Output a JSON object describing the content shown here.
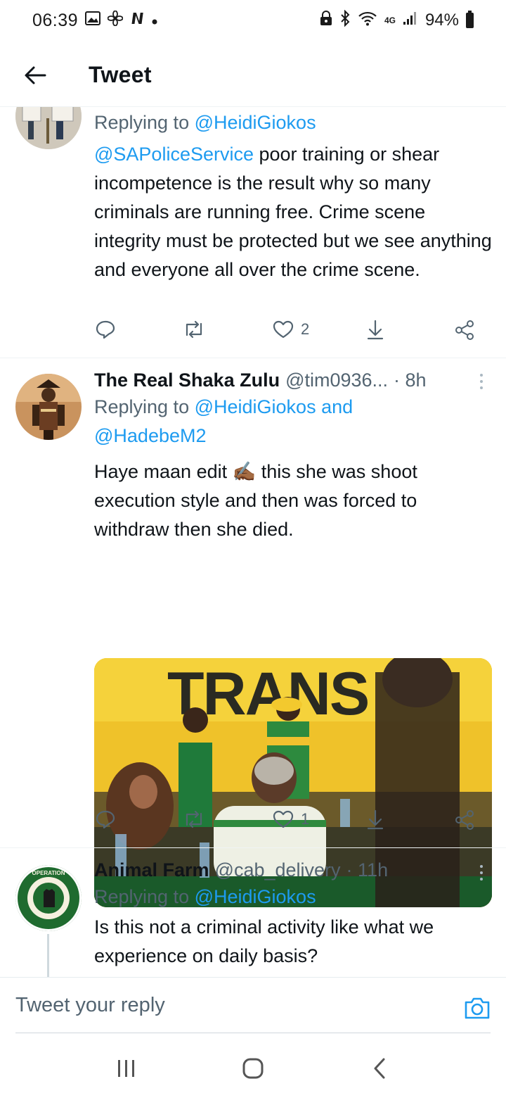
{
  "status_bar": {
    "time": "06:39",
    "network": "4G",
    "battery": "94%"
  },
  "header": {
    "title": "Tweet"
  },
  "tweets": [
    {
      "reply_prefix": "Replying to ",
      "reply_to": "@HeidiGiokos",
      "mention": "@SAPoliceService",
      "text": " poor training or shear incompetence is the result why so many criminals are running free. Crime scene integrity must be protected but we see anything and everyone all over the crime scene.",
      "likes": "2"
    },
    {
      "name": "The Real Shaka Zulu",
      "handle": "@tim0936...",
      "time": "· 8h",
      "reply_prefix": "Replying to ",
      "reply_to_1": "@HeidiGiokos",
      "reply_join": " and",
      "reply_to_2": "@HadebeM2",
      "text_before_emoji": "Haye maan edit ",
      "emoji": "✍🏾",
      "text_after_emoji": " this she was shoot execution style and then was forced to withdraw then she died.",
      "media_sign": "TRANS",
      "likes": "1"
    },
    {
      "name": "Animal Farm",
      "handle": "@cab_delivery",
      "time": "· 11h",
      "reply_prefix": "Replying to ",
      "reply_to": "@HeidiGiokos",
      "text": "Is this not a criminal activity like what we experience on daily basis?"
    }
  ],
  "reply_bar": {
    "placeholder": "Tweet your reply"
  },
  "colors": {
    "link": "#1d9bf0",
    "text": "#0f1419",
    "muted": "#536471"
  }
}
